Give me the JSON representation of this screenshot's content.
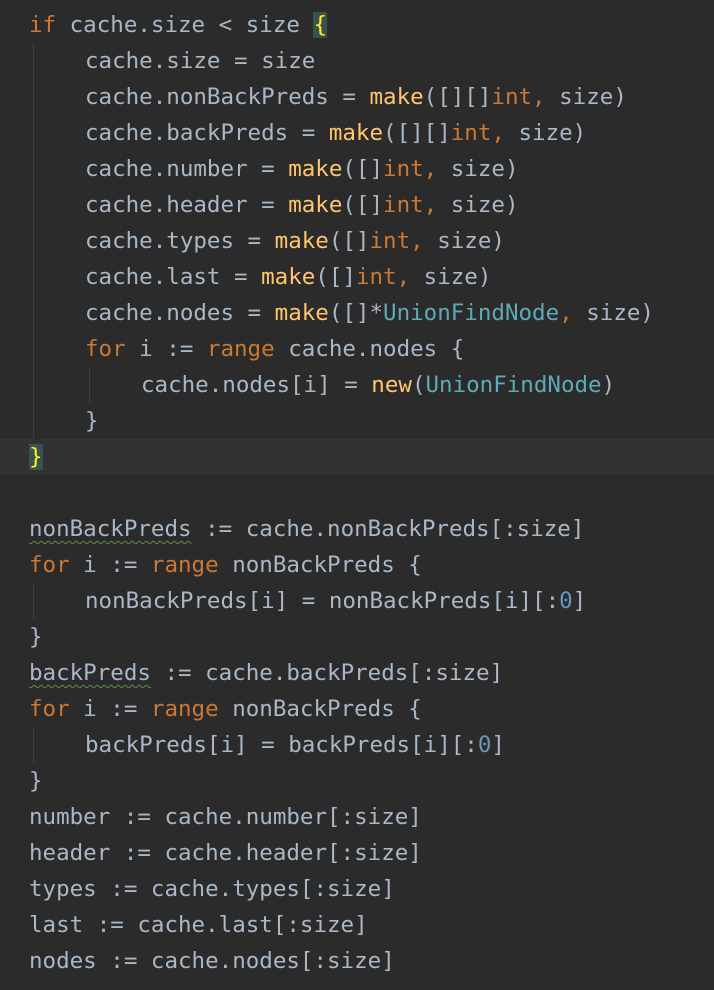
{
  "editor": {
    "language": "go",
    "current_line": 12,
    "lines": [
      {
        "indent": 0,
        "tokens": [
          [
            "kw",
            "if"
          ],
          [
            "plain",
            " cache.size < size "
          ],
          [
            "brace-match",
            "{"
          ]
        ]
      },
      {
        "indent": 1,
        "tokens": [
          [
            "plain",
            "cache.size = size"
          ]
        ]
      },
      {
        "indent": 1,
        "tokens": [
          [
            "plain",
            "cache.nonBackPreds = "
          ],
          [
            "fn",
            "make"
          ],
          [
            "plain",
            "([][]"
          ],
          [
            "kw",
            "int"
          ],
          [
            "kw",
            ","
          ],
          [
            "plain",
            " size)"
          ]
        ]
      },
      {
        "indent": 1,
        "tokens": [
          [
            "plain",
            "cache.backPreds = "
          ],
          [
            "fn",
            "make"
          ],
          [
            "plain",
            "([][]"
          ],
          [
            "kw",
            "int"
          ],
          [
            "kw",
            ","
          ],
          [
            "plain",
            " size)"
          ]
        ]
      },
      {
        "indent": 1,
        "tokens": [
          [
            "plain",
            "cache.number = "
          ],
          [
            "fn",
            "make"
          ],
          [
            "plain",
            "([]"
          ],
          [
            "kw",
            "int"
          ],
          [
            "kw",
            ","
          ],
          [
            "plain",
            " size)"
          ]
        ]
      },
      {
        "indent": 1,
        "tokens": [
          [
            "plain",
            "cache.header = "
          ],
          [
            "fn",
            "make"
          ],
          [
            "plain",
            "([]"
          ],
          [
            "kw",
            "int"
          ],
          [
            "kw",
            ","
          ],
          [
            "plain",
            " size)"
          ]
        ]
      },
      {
        "indent": 1,
        "tokens": [
          [
            "plain",
            "cache.types = "
          ],
          [
            "fn",
            "make"
          ],
          [
            "plain",
            "([]"
          ],
          [
            "kw",
            "int"
          ],
          [
            "kw",
            ","
          ],
          [
            "plain",
            " size)"
          ]
        ]
      },
      {
        "indent": 1,
        "tokens": [
          [
            "plain",
            "cache.last = "
          ],
          [
            "fn",
            "make"
          ],
          [
            "plain",
            "([]"
          ],
          [
            "kw",
            "int"
          ],
          [
            "kw",
            ","
          ],
          [
            "plain",
            " size)"
          ]
        ]
      },
      {
        "indent": 1,
        "tokens": [
          [
            "plain",
            "cache.nodes = "
          ],
          [
            "fn",
            "make"
          ],
          [
            "plain",
            "([]*"
          ],
          [
            "type",
            "UnionFindNode"
          ],
          [
            "kw",
            ","
          ],
          [
            "plain",
            " size)"
          ]
        ]
      },
      {
        "indent": 1,
        "tokens": [
          [
            "kw",
            "for"
          ],
          [
            "plain",
            " i := "
          ],
          [
            "kw",
            "range"
          ],
          [
            "plain",
            " cache.nodes {"
          ]
        ]
      },
      {
        "indent": 2,
        "tokens": [
          [
            "plain",
            "cache.nodes[i] = "
          ],
          [
            "fn",
            "new"
          ],
          [
            "plain",
            "("
          ],
          [
            "type",
            "UnionFindNode"
          ],
          [
            "plain",
            ")"
          ]
        ]
      },
      {
        "indent": 1,
        "tokens": [
          [
            "plain",
            "}"
          ]
        ]
      },
      {
        "indent": 0,
        "tokens": [
          [
            "brace-match",
            "}"
          ]
        ]
      },
      {
        "indent": 0,
        "tokens": []
      },
      {
        "indent": 0,
        "tokens": [
          [
            "squiggle",
            "nonBackPreds"
          ],
          [
            "plain",
            " := cache.nonBackPreds[:size]"
          ]
        ]
      },
      {
        "indent": 0,
        "tokens": [
          [
            "kw",
            "for"
          ],
          [
            "plain",
            " i := "
          ],
          [
            "kw",
            "range"
          ],
          [
            "plain",
            " nonBackPreds {"
          ]
        ]
      },
      {
        "indent": 1,
        "tokens": [
          [
            "plain",
            "nonBackPreds[i] = nonBackPreds[i][:"
          ],
          [
            "num",
            "0"
          ],
          [
            "plain",
            "]"
          ]
        ]
      },
      {
        "indent": 0,
        "tokens": [
          [
            "plain",
            "}"
          ]
        ]
      },
      {
        "indent": 0,
        "tokens": [
          [
            "squiggle",
            "backPreds"
          ],
          [
            "plain",
            " := cache.backPreds[:size]"
          ]
        ]
      },
      {
        "indent": 0,
        "tokens": [
          [
            "kw",
            "for"
          ],
          [
            "plain",
            " i := "
          ],
          [
            "kw",
            "range"
          ],
          [
            "plain",
            " nonBackPreds {"
          ]
        ]
      },
      {
        "indent": 1,
        "tokens": [
          [
            "plain",
            "backPreds[i] = backPreds[i][:"
          ],
          [
            "num",
            "0"
          ],
          [
            "plain",
            "]"
          ]
        ]
      },
      {
        "indent": 0,
        "tokens": [
          [
            "plain",
            "}"
          ]
        ]
      },
      {
        "indent": 0,
        "tokens": [
          [
            "plain",
            "number := cache.number[:size]"
          ]
        ]
      },
      {
        "indent": 0,
        "tokens": [
          [
            "plain",
            "header := cache.header[:size]"
          ]
        ]
      },
      {
        "indent": 0,
        "tokens": [
          [
            "plain",
            "types := cache.types[:size]"
          ]
        ]
      },
      {
        "indent": 0,
        "tokens": [
          [
            "plain",
            "last := cache.last[:size]"
          ]
        ]
      },
      {
        "indent": 0,
        "tokens": [
          [
            "plain",
            "nodes := cache.nodes[:size]"
          ]
        ]
      }
    ]
  }
}
